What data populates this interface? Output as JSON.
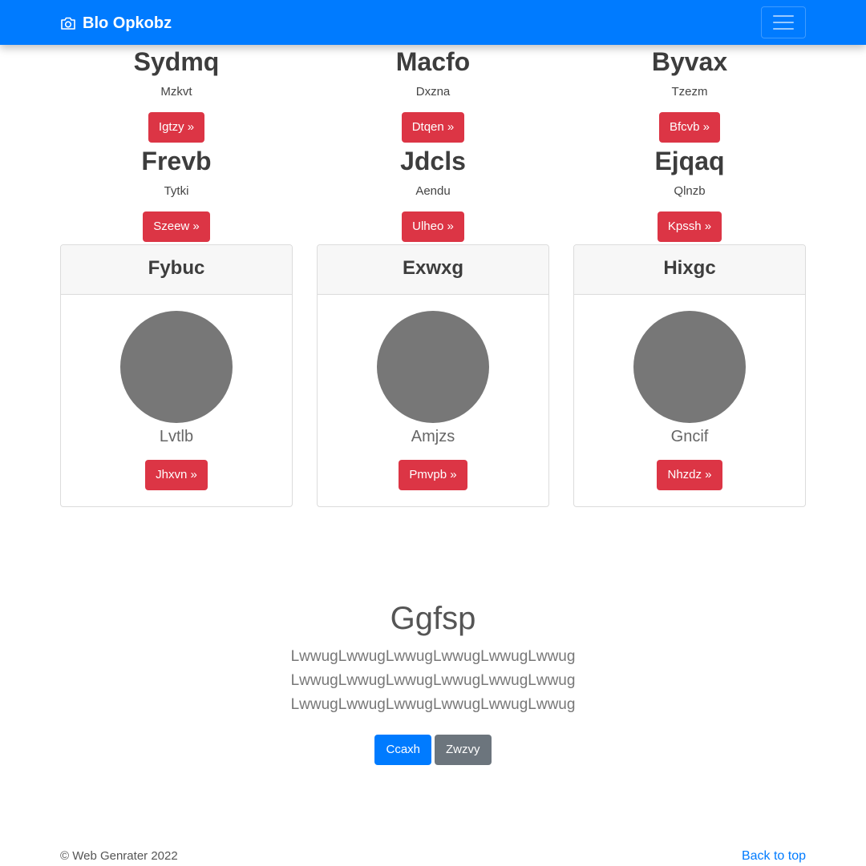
{
  "navbar": {
    "brand": "Blo Opkobz",
    "brand_icon": "camera-icon",
    "toggler_icon": "hamburger-icon",
    "bg_color": "#007bff"
  },
  "features": [
    {
      "title": "Sydmq",
      "text": "Mzkvt",
      "button": "Igtzy »"
    },
    {
      "title": "Macfo",
      "text": "Dxzna",
      "button": "Dtqen »"
    },
    {
      "title": "Byvax",
      "text": "Tzezm",
      "button": "Bfcvb »"
    },
    {
      "title": "Frevb",
      "text": "Tytki",
      "button": "Szeew »"
    },
    {
      "title": "Jdcls",
      "text": "Aendu",
      "button": "Ulheo »"
    },
    {
      "title": "Ejqaq",
      "text": "Qlnzb",
      "button": "Kpssh »"
    }
  ],
  "cards": [
    {
      "header": "Fybuc",
      "label": "Lvtlb",
      "button": "Jhxvn »"
    },
    {
      "header": "Exwxg",
      "label": "Amjzs",
      "button": "Pmvpb »"
    },
    {
      "header": "Hixgc",
      "label": "Gncif",
      "button": "Nhzdz »"
    }
  ],
  "hero": {
    "title": "Ggfsp",
    "lines": [
      "LwwugLwwugLwwugLwwugLwwugLwwug",
      "LwwugLwwugLwwugLwwugLwwugLwwug",
      "LwwugLwwugLwwugLwwugLwwugLwwug"
    ],
    "primary_button": "Ccaxh",
    "secondary_button": "Zwzvy"
  },
  "footer": {
    "copyright": "© Web Genrater 2022",
    "back_to_top": "Back to top"
  },
  "colors": {
    "primary": "#007bff",
    "danger": "#dc3545",
    "secondary": "#6c757d",
    "avatar": "#777777"
  }
}
